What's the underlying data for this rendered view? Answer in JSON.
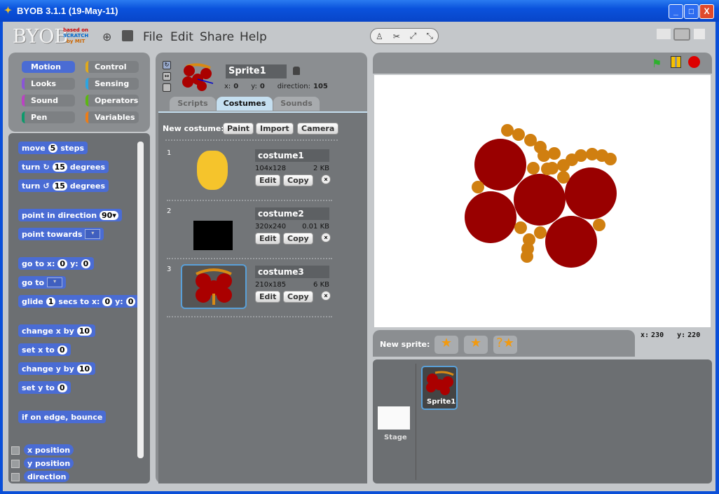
{
  "window": {
    "title": "BYOB 3.1.1 (19-May-11)",
    "minimize": "_",
    "maximize": "□",
    "close": "X"
  },
  "logo": {
    "text": "BYOB",
    "sub": [
      "based on",
      "SCRATCH",
      "by MIT"
    ]
  },
  "menu": [
    "File",
    "Edit",
    "Share",
    "Help"
  ],
  "categories": [
    {
      "label": "Motion",
      "color": "#4a6cd4"
    },
    {
      "label": "Control",
      "color": "#e1a91a"
    },
    {
      "label": "Looks",
      "color": "#8a55d7"
    },
    {
      "label": "Sensing",
      "color": "#2ca5e2"
    },
    {
      "label": "Sound",
      "color": "#bb42c3"
    },
    {
      "label": "Operators",
      "color": "#5cb712"
    },
    {
      "label": "Pen",
      "color": "#0e9a6c"
    },
    {
      "label": "Variables",
      "color": "#ee7d16"
    }
  ],
  "palette": {
    "groups": [
      [
        [
          {
            "t": "move"
          },
          {
            "in": "5"
          },
          {
            "t": "steps"
          }
        ],
        [
          {
            "t": "turn"
          },
          {
            "icon": "↻"
          },
          {
            "in": "15"
          },
          {
            "t": "degrees"
          }
        ],
        [
          {
            "t": "turn"
          },
          {
            "icon": "↺"
          },
          {
            "in": "15"
          },
          {
            "t": "degrees"
          }
        ]
      ],
      [
        [
          {
            "t": "point in direction"
          },
          {
            "in": "90▾"
          }
        ],
        [
          {
            "t": "point towards"
          },
          {
            "dd": "▾"
          }
        ]
      ],
      [
        [
          {
            "t": "go to x:"
          },
          {
            "in": "0"
          },
          {
            "t": "y:"
          },
          {
            "in": "0"
          }
        ],
        [
          {
            "t": "go to"
          },
          {
            "dd": "▾"
          }
        ],
        [
          {
            "t": "glide"
          },
          {
            "in": "1"
          },
          {
            "t": "secs to x:"
          },
          {
            "in": "0"
          },
          {
            "t": "y:"
          },
          {
            "in": "0"
          }
        ]
      ],
      [
        [
          {
            "t": "change x by"
          },
          {
            "in": "10"
          }
        ],
        [
          {
            "t": "set x to"
          },
          {
            "in": "0"
          }
        ],
        [
          {
            "t": "change y by"
          },
          {
            "in": "10"
          }
        ],
        [
          {
            "t": "set y to"
          },
          {
            "in": "0"
          }
        ]
      ],
      [
        [
          {
            "t": "if on edge, bounce"
          }
        ]
      ]
    ],
    "reporters": [
      "x position",
      "y position",
      "direction"
    ]
  },
  "sprite": {
    "name": "Sprite1",
    "x_label": "x:",
    "x": "0",
    "y_label": "y:",
    "y": "0",
    "direction_label": "direction:",
    "direction": "105"
  },
  "tabs": [
    {
      "label": "Scripts"
    },
    {
      "label": "Costumes",
      "active": true
    },
    {
      "label": "Sounds"
    }
  ],
  "costumes": {
    "new_label": "New costume:",
    "buttons": [
      "Paint",
      "Import",
      "Camera"
    ],
    "items": [
      {
        "num": "1",
        "name": "costume1",
        "size": "104x128",
        "kb": "2 KB"
      },
      {
        "num": "2",
        "name": "costume2",
        "size": "320x240",
        "kb": "0.01 KB"
      },
      {
        "num": "3",
        "name": "costume3",
        "size": "210x185",
        "kb": "6 KB",
        "selected": true
      }
    ],
    "edit": "Edit",
    "copy": "Copy"
  },
  "stage": {
    "mouse_x_label": "x:",
    "mouse_x": "230",
    "mouse_y_label": "y:",
    "mouse_y": "220"
  },
  "corral": {
    "new_sprite_label": "New sprite:",
    "stage_label": "Stage",
    "sprites": [
      "Sprite1"
    ]
  }
}
